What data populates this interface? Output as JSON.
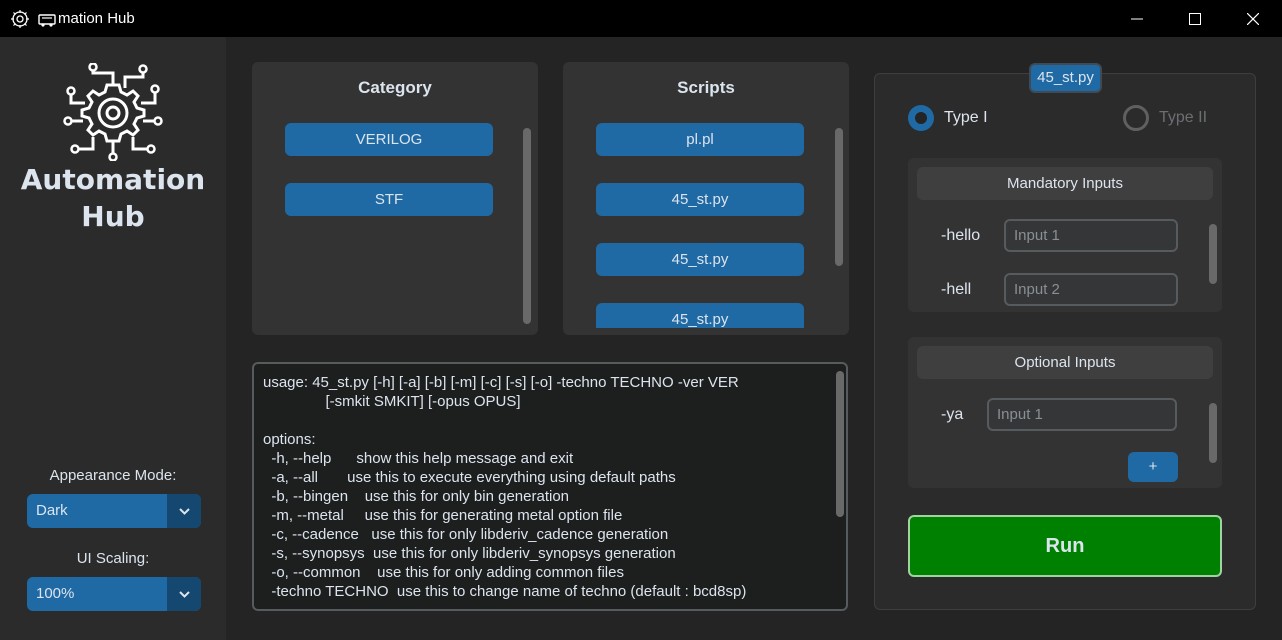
{
  "window": {
    "title": "mation Hub"
  },
  "sidebar": {
    "brand_line1": "Automation",
    "brand_line2": "Hub",
    "appearance_label": "Appearance Mode:",
    "appearance_value": "Dark",
    "scaling_label": "UI Scaling:",
    "scaling_value": "100%"
  },
  "category": {
    "title": "Category",
    "items": [
      "VERILOG",
      "STF"
    ]
  },
  "scripts": {
    "title": "Scripts",
    "items": [
      "pl.pl",
      "45_st.py",
      "45_st.py",
      "45_st.py"
    ]
  },
  "help_text": "usage: 45_st.py [-h] [-a] [-b] [-m] [-c] [-s] [-o] -techno TECHNO -ver VER\n               [-smkit SMKIT] [-opus OPUS]\n\noptions:\n  -h, --help      show this help message and exit\n  -a, --all       use this to execute everything using default paths\n  -b, --bingen    use this for only bin generation\n  -m, --metal     use this for generating metal option file\n  -c, --cadence   use this for only libderiv_cadence generation\n  -s, --synopsys  use this for only libderiv_synopsys generation\n  -o, --common    use this for only adding common files\n  -techno TECHNO  use this to change name of techno (default : bcd8sp)",
  "panel": {
    "selected_script": "45_st.py",
    "type1_label": "Type I",
    "type2_label": "Type II",
    "mandatory": {
      "title": "Mandatory Inputs",
      "args": [
        {
          "label": "-hello",
          "placeholder": "Input 1"
        },
        {
          "label": "-hell",
          "placeholder": "Input 2"
        }
      ]
    },
    "optional": {
      "title": "Optional Inputs",
      "args": [
        {
          "label": "-ya",
          "placeholder": "Input 1"
        }
      ],
      "add_label": "+"
    },
    "run_label": "Run"
  },
  "colors": {
    "accent": "#1f6aa5",
    "run": "#008000",
    "background": "#242424"
  }
}
